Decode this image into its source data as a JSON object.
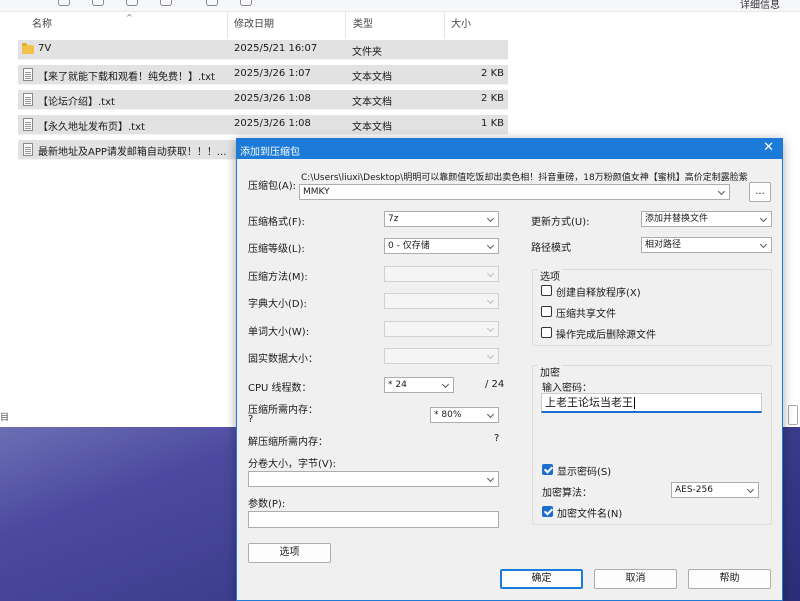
{
  "explorer": {
    "top_right_text": "详细信息",
    "columns": [
      {
        "label": "名称"
      },
      {
        "label": "修改日期"
      },
      {
        "label": "类型"
      },
      {
        "label": "大小"
      }
    ],
    "files": [
      {
        "name": "7V",
        "date": "2025/5/21 16:07",
        "type": "文件夹",
        "size": "",
        "icon": "folder-icon"
      },
      {
        "name": "【来了就能下载和观看！纯免费！】.txt",
        "date": "2025/3/26 1:07",
        "type": "文本文档",
        "size": "2 KB",
        "icon": "text-file-icon"
      },
      {
        "name": "【论坛介绍】.txt",
        "date": "2025/3/26 1:08",
        "type": "文本文档",
        "size": "2 KB",
        "icon": "text-file-icon"
      },
      {
        "name": "【永久地址发布页】.txt",
        "date": "2025/3/26 1:08",
        "type": "文本文档",
        "size": "1 KB",
        "icon": "text-file-icon"
      },
      {
        "name": "最新地址及APP请发邮箱自动获取！！！...",
        "date": "",
        "type": "",
        "size": "",
        "icon": "text-file-icon"
      }
    ],
    "status_text": "目"
  },
  "dialog": {
    "title": "添加到压缩包",
    "close_glyph": "✕",
    "archive_label": "压缩包(A):",
    "archive_path": "C:\\Users\\liuxi\\Desktop\\明明可以靠颜值吃饭却出卖色相！抖音重磅，18万粉颜值女神【蜜桃】高价定制露脸紫",
    "archive_name": "MMKY",
    "browse_label": "...",
    "left": {
      "format_label": "压缩格式(F):",
      "format_value": "7z",
      "level_label": "压缩等级(L):",
      "level_value": "0 - 仅存储",
      "method_label": "压缩方法(M):",
      "dict_label": "字典大小(D):",
      "word_label": "单词大小(W):",
      "solid_label": "固实数据大小：",
      "cpu_label": "CPU 线程数：",
      "cpu_value": "* 24",
      "cpu_total": "/ 24",
      "mem_label": "压缩所需内存：",
      "mem_hint": "?",
      "mem_value": "* 80%",
      "demem_label": "解压缩所需内存：",
      "demem_hint": "?",
      "split_label": "分卷大小，字节(V):",
      "params_label": "参数(P):",
      "options_button": "选项"
    },
    "right": {
      "update_label": "更新方式(U):",
      "update_value": "添加并替换文件",
      "path_label": "路径模式",
      "path_value": "相对路径",
      "options_group": "选项",
      "opt_sfx": "创建自释放程序(X)",
      "opt_shared": "压缩共享文件",
      "opt_delete": "操作完成后删除源文件",
      "encryption_group": "加密",
      "password_label": "输入密码：",
      "password_value": "上老王论坛当老王",
      "show_password": "显示密码(S)",
      "enc_method_label": "加密算法：",
      "enc_method_value": "AES-256",
      "encrypt_names": "加密文件名(N)"
    },
    "buttons": {
      "ok": "确定",
      "cancel": "取消",
      "help": "帮助"
    }
  },
  "colors": {
    "accent": "#1c7ad8",
    "row_selected": "#e2e2e2",
    "folder": "#f3c14a"
  }
}
